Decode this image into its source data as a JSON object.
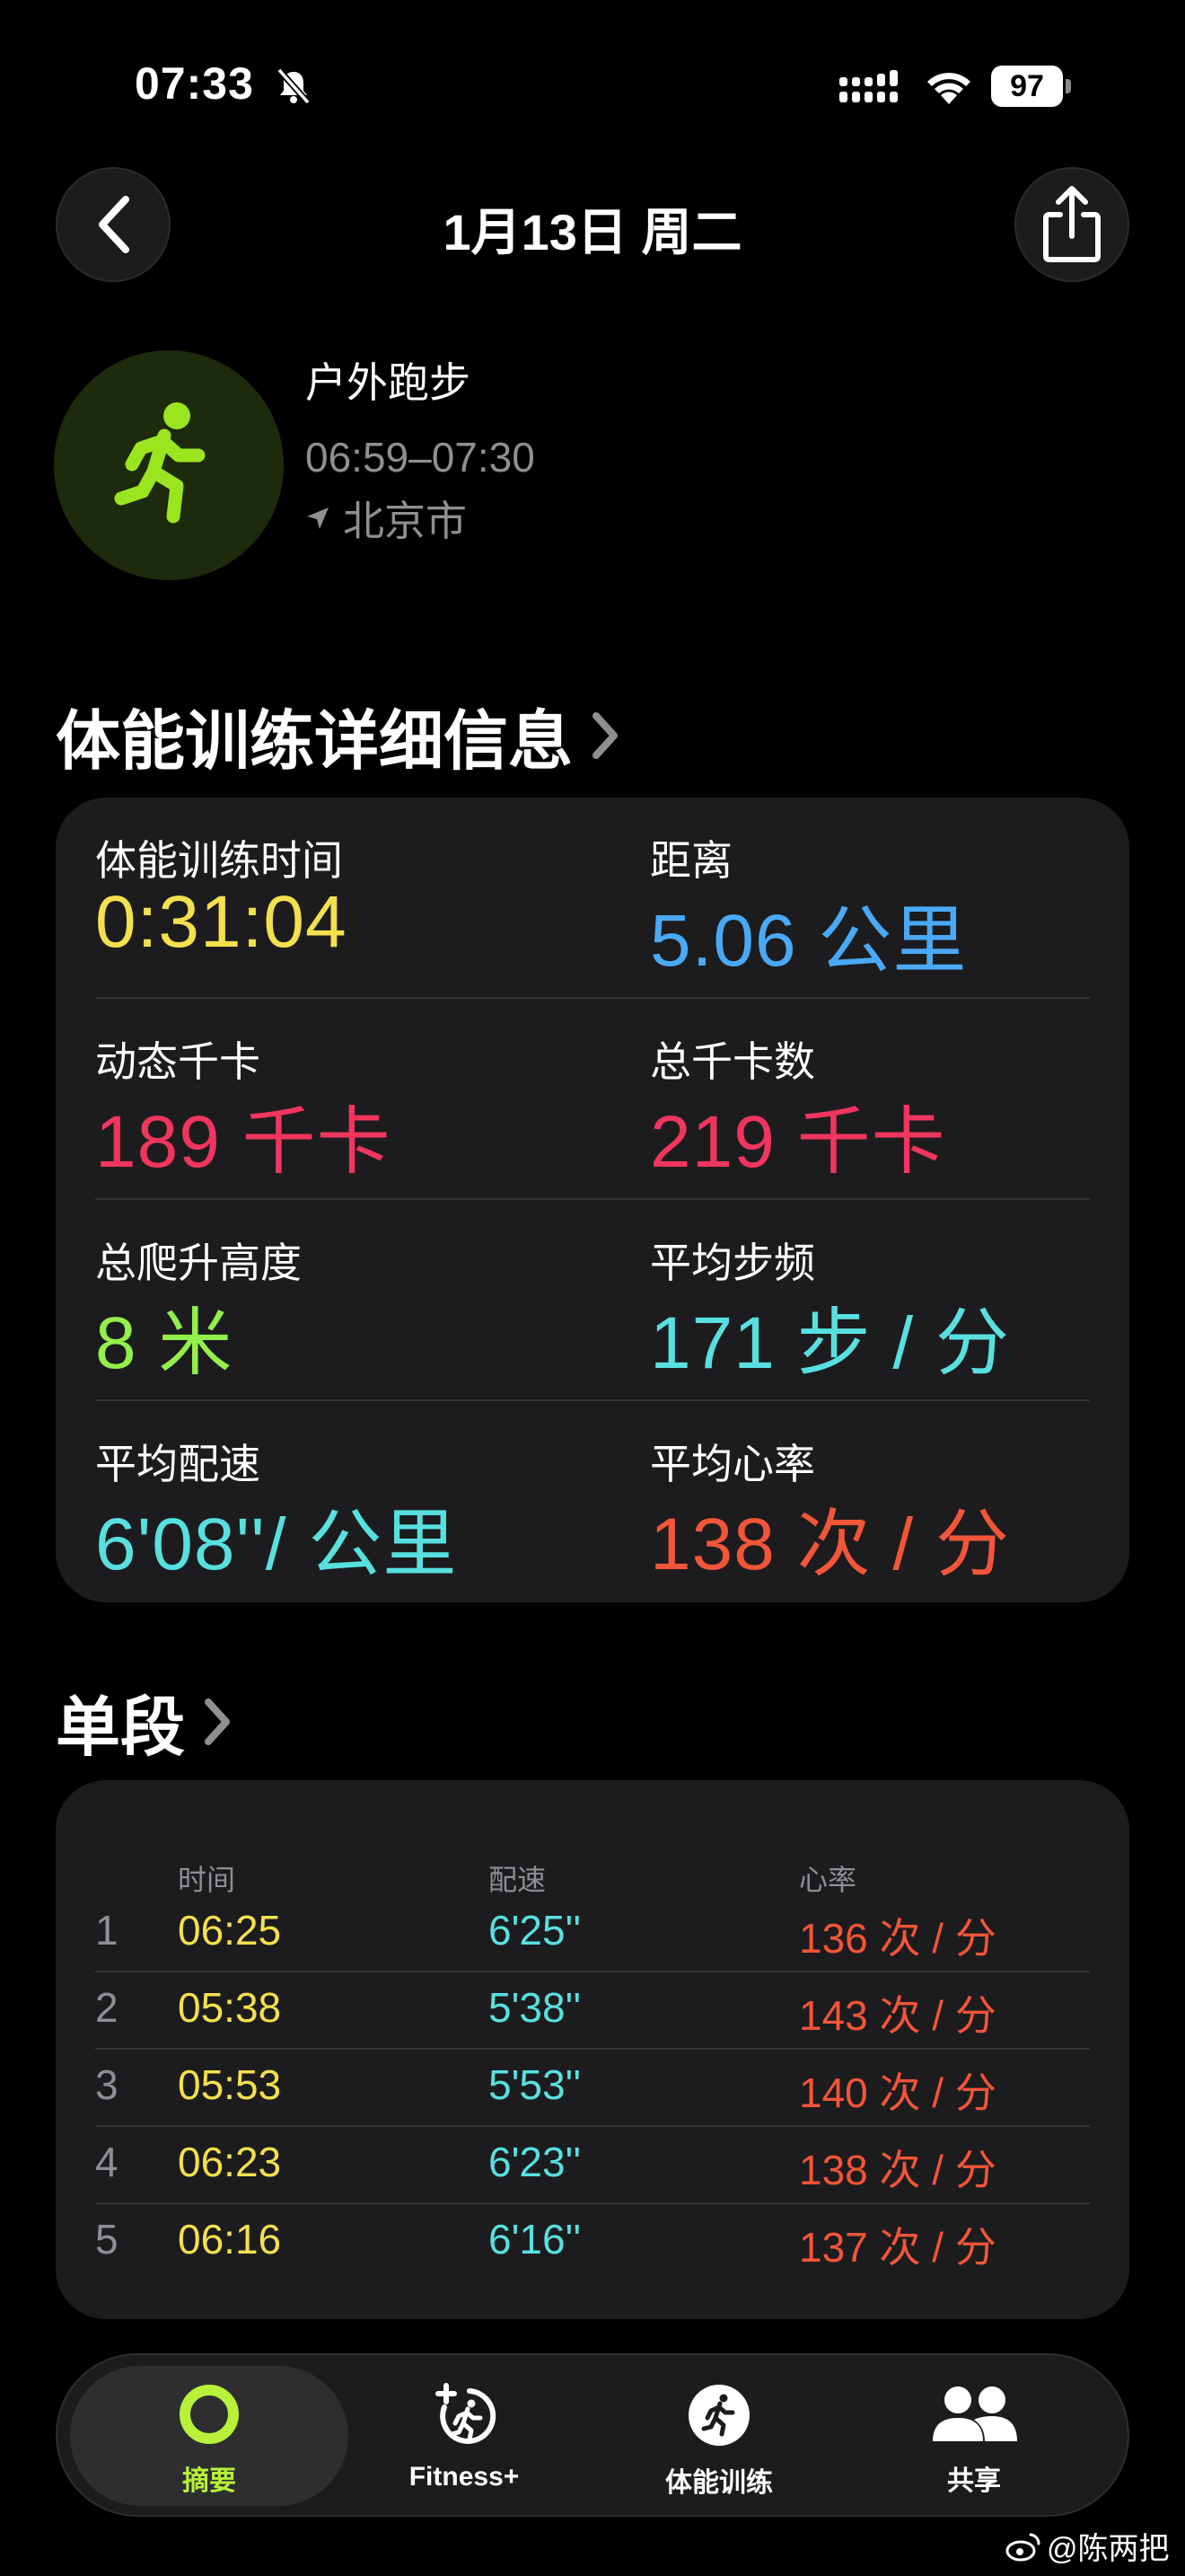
{
  "status_bar": {
    "time": "07:33",
    "battery": "97"
  },
  "nav": {
    "title": "1月13日 周二"
  },
  "workout": {
    "type": "户外跑步",
    "time_range": "06:59–07:30",
    "location": "北京市",
    "accent": "#9be51f"
  },
  "details": {
    "title": "体能训练详细信息",
    "metrics": [
      {
        "label": "体能训练时间",
        "value": "0:31:04",
        "color": "#f4e04d"
      },
      {
        "label": "距离",
        "value": "5.06 公里",
        "color": "#4aa9f5"
      },
      {
        "label": "动态千卡",
        "value": "189 千卡",
        "color": "#f0355f"
      },
      {
        "label": "总千卡数",
        "value": "219 千卡",
        "color": "#f0355f"
      },
      {
        "label": "总爬升高度",
        "value": "8 米",
        "color": "#93ef4b"
      },
      {
        "label": "平均步频",
        "value": "171 步 / 分",
        "color": "#58e0e0"
      },
      {
        "label": "平均配速",
        "value": "6'08''/ 公里",
        "color": "#58e0e0"
      },
      {
        "label": "平均心率",
        "value": "138 次 / 分",
        "color": "#f25538"
      }
    ]
  },
  "splits": {
    "title": "单段",
    "headers": [
      "时间",
      "配速",
      "心率"
    ],
    "rows": [
      {
        "index": "1",
        "time": "06:25",
        "pace": "6'25''",
        "hr": "136 次 / 分"
      },
      {
        "index": "2",
        "time": "05:38",
        "pace": "5'38''",
        "hr": "143 次 / 分"
      },
      {
        "index": "3",
        "time": "05:53",
        "pace": "5'53''",
        "hr": "140 次 / 分"
      },
      {
        "index": "4",
        "time": "06:23",
        "pace": "6'23''",
        "hr": "138 次 / 分"
      },
      {
        "index": "5",
        "time": "06:16",
        "pace": "6'16''",
        "hr": "137 次 / 分"
      }
    ],
    "colors": {
      "time": "#f4e04d",
      "pace": "#58e0e0",
      "hr": "#f25538"
    }
  },
  "tabs": [
    {
      "label": "摘要",
      "icon": "activity-ring-icon",
      "active": true
    },
    {
      "label": "Fitness+",
      "icon": "fitness-plus-icon",
      "active": false
    },
    {
      "label": "体能训练",
      "icon": "workout-runner-icon",
      "active": false
    },
    {
      "label": "共享",
      "icon": "sharing-people-icon",
      "active": false
    }
  ],
  "watermark": "@陈两把"
}
